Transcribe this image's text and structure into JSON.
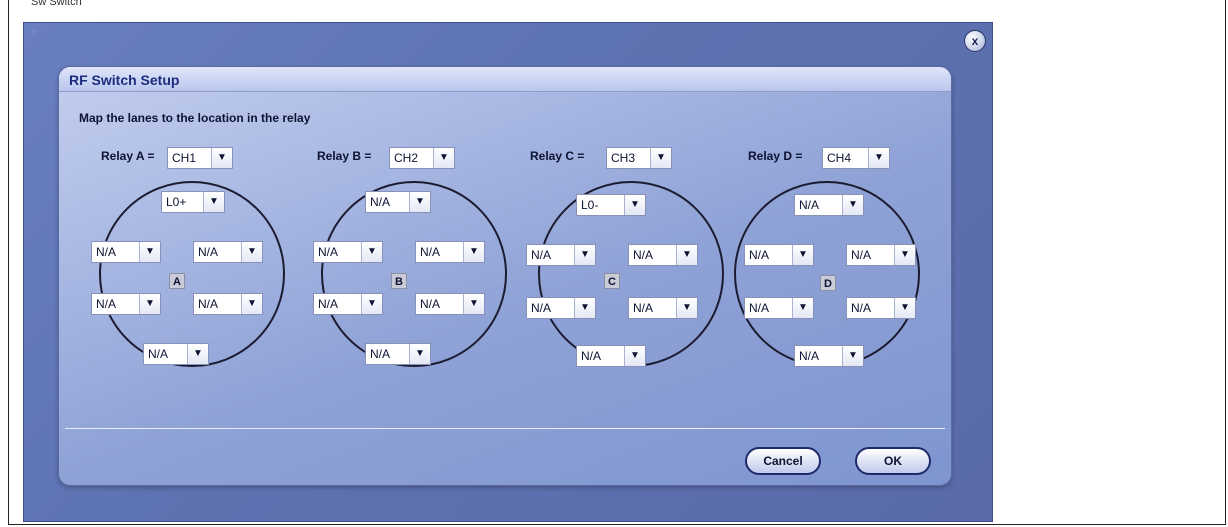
{
  "window": {
    "title_fragment": "Sw Switch"
  },
  "dialog": {
    "title": "RF Switch Setup",
    "instruction": "Map the lanes to the location in the relay",
    "close_label": "x",
    "cancel_label": "Cancel",
    "ok_label": "OK"
  },
  "relays": [
    {
      "label": "Relay A =",
      "channel": "CH1",
      "tag": "A",
      "top": "L0+",
      "ul": "N/A",
      "ur": "N/A",
      "ll": "N/A",
      "lr": "N/A",
      "bottom": "N/A"
    },
    {
      "label": "Relay B =",
      "channel": "CH2",
      "tag": "B",
      "top": "N/A",
      "ul": "N/A",
      "ur": "N/A",
      "ll": "N/A",
      "lr": "N/A",
      "bottom": "N/A"
    },
    {
      "label": "Relay C =",
      "channel": "CH3",
      "tag": "C",
      "top": "L0-",
      "ul": "N/A",
      "ur": "N/A",
      "ll": "N/A",
      "lr": "N/A",
      "bottom": "N/A"
    },
    {
      "label": "Relay D =",
      "channel": "CH4",
      "tag": "D",
      "top": "N/A",
      "ul": "N/A",
      "ur": "N/A",
      "ll": "N/A",
      "lr": "N/A",
      "bottom": "N/A"
    }
  ],
  "icons": {
    "dropdown": "chevron-down-icon",
    "arrow_glyph": "▼"
  }
}
